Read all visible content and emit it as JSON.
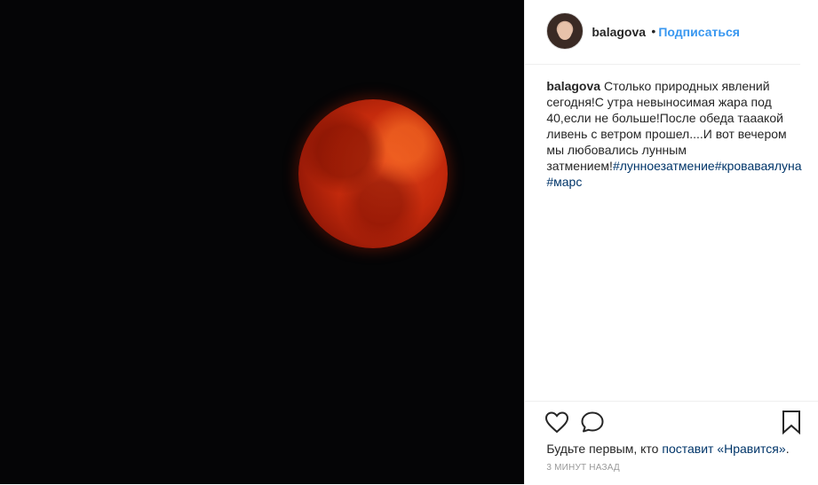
{
  "post": {
    "photo": {
      "subject": "red-moon"
    },
    "header": {
      "username": "balagova",
      "separator": "•",
      "follow_label": "Подписаться"
    },
    "caption": {
      "username": "balagova",
      "text": " Столько природных явлений сегодня!С утра невыносимая жара под 40,если не больше!После обеда тааакой ливень с ветром прошел....И вот вечером мы любовались лунным затмением!",
      "tags": [
        "#лунноезатмение",
        "#кроваваялуна",
        "#марс"
      ]
    },
    "actions": {
      "like_icon": "heart-icon",
      "comment_icon": "comment-icon",
      "save_icon": "bookmark-icon"
    },
    "likes": {
      "prefix": "Будьте первым, кто ",
      "action": "поставит «Нравится»",
      "suffix": "."
    },
    "timestamp": "3 минут назад"
  },
  "colors": {
    "accent": "#3897f0",
    "hashtag": "#003569",
    "muted": "#999999",
    "text": "#262626"
  }
}
